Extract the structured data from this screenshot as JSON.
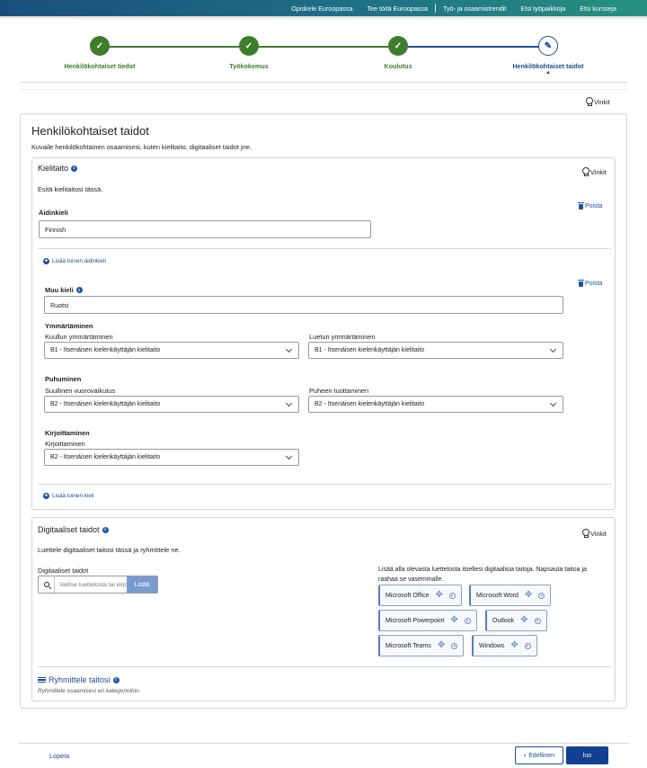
{
  "topnav": [
    "Opiskele Euroopassa",
    "Tee töitä Euroopassa",
    "Työ- ja osaamistrendit",
    "Etsi työpaikkoja",
    "Etsi kursseja"
  ],
  "steps": [
    {
      "label": "Henkilökohtaiset tiedot",
      "state": "done"
    },
    {
      "label": "Työkokemus",
      "state": "done"
    },
    {
      "label": "Koulutus",
      "state": "done"
    },
    {
      "label": "Henkilökohtaiset taidot",
      "state": "current"
    }
  ],
  "tips_label": "Vinkit",
  "page": {
    "title": "Henkilökohtaiset taidot",
    "subtitle": "Kuvaile henkilökohtainen osaamisesi, kuten kielitaito, digitaaliset taidot jne."
  },
  "language": {
    "title": "Kielitaito",
    "intro": "Esitä kielitaitosi tässä.",
    "remove_label": "Poista",
    "mother_tongue_label": "Äidinkieli",
    "mother_tongue_value": "Finnish",
    "add_mother_tongue": "Lisää toinen äidinkieli",
    "other_language_label": "Muu kieli",
    "other_language_value": "Ruotsi",
    "understanding": "Ymmärtäminen",
    "listening_label": "Kuullun ymmärtäminen",
    "listening_value": "B1 - Itsenäisen kielenkäyttäjän kielitaito",
    "reading_label": "Luetun ymmärtäminen",
    "reading_value": "B1 - Itsenäisen kielenkäyttäjän kielitaito",
    "speaking": "Puhuminen",
    "interaction_label": "Suullinen vuorovaikutus",
    "interaction_value": "B2 - Itsenäisen kielenkäyttäjän kielitaito",
    "production_label": "Puheen tuottaminen",
    "production_value": "B2 - Itsenäisen kielenkäyttäjän kielitaito",
    "writing": "Kirjoittaminen",
    "writing_label": "Kirjoittaminen",
    "writing_value": "B2 - Itsenäisen kielenkäyttäjän kielitaito",
    "add_language": "Lisää toinen kieli"
  },
  "digital": {
    "title": "Digitaaliset taidot",
    "intro": "Luettele digitaaliset taitosi tässä ja ryhmittele ne.",
    "field_label": "Digitaaliset taidot",
    "search_placeholder": "Valitse luettelosta tai kirjoita",
    "add_button": "Lisää",
    "suggest_text_1": "Lisää alla olevasta luettelosta itsellesi digitaalisia taitoja. Napsauta taitoa ja",
    "suggest_text_2": "raahaa se vasemmalle.",
    "chips": [
      "Microsoft Office",
      "Microsoft Word",
      "Microsoft Powerpoint",
      "Outlook",
      "Microsoft Teams",
      "Windows"
    ],
    "group_title": "Ryhmittele taitosi",
    "group_hint": "Ryhmittele osaamisesi eri kategorioihin."
  },
  "footer": {
    "quit": "Lopeta",
    "prev": "Edellinen",
    "next": "luo"
  },
  "colors": {
    "done": "#3e7d2c",
    "current": "#1a4e95",
    "primary_button": "#123f91"
  }
}
